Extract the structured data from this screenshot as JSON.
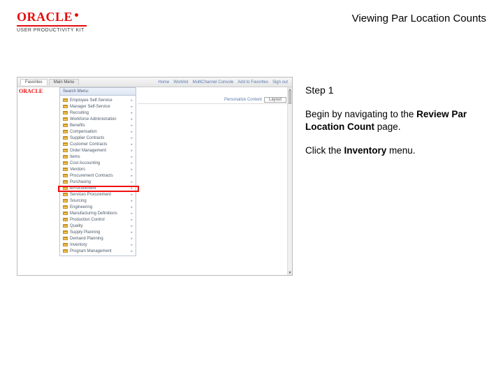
{
  "brand": {
    "name": "ORACLE",
    "product": "USER PRODUCTIVITY KIT"
  },
  "page_title": "Viewing Par Location Counts",
  "step": {
    "label": "Step 1"
  },
  "instructions": {
    "p1_pre": "Begin by navigating to the ",
    "p1_bold": "Review Par Location Count",
    "p1_post": " page.",
    "p2_pre": "Click the ",
    "p2_bold": "Inventory",
    "p2_post": " menu."
  },
  "screenshot": {
    "tab_favorites": "Favorites",
    "tab_main": "Main Menu",
    "nav_links": [
      "Home",
      "Worklist",
      "MultiChannel Console",
      "Add to Favorites",
      "Sign out"
    ],
    "panel_header": "Search Menu:",
    "brand_small": "ORACLE",
    "personalize_label": "Personalize Content",
    "layout_label": "Layout",
    "menu_items": [
      "Employee Self-Service",
      "Manager Self-Service",
      "Recruiting",
      "Workforce Administration",
      "Benefits",
      "Compensation",
      "Supplier Contracts",
      "Customer Contracts",
      "Order Management",
      "Items",
      "Cost Accounting",
      "Vendors",
      "Procurement Contracts",
      "Purchasing",
      "eProcurement",
      "Services Procurement",
      "Sourcing",
      "Engineering",
      "Manufacturing Definitions",
      "Production Control",
      "Quality",
      "Supply Planning",
      "Demand Planning",
      "Inventory",
      "Program Management"
    ],
    "highlighted_index": 14
  }
}
